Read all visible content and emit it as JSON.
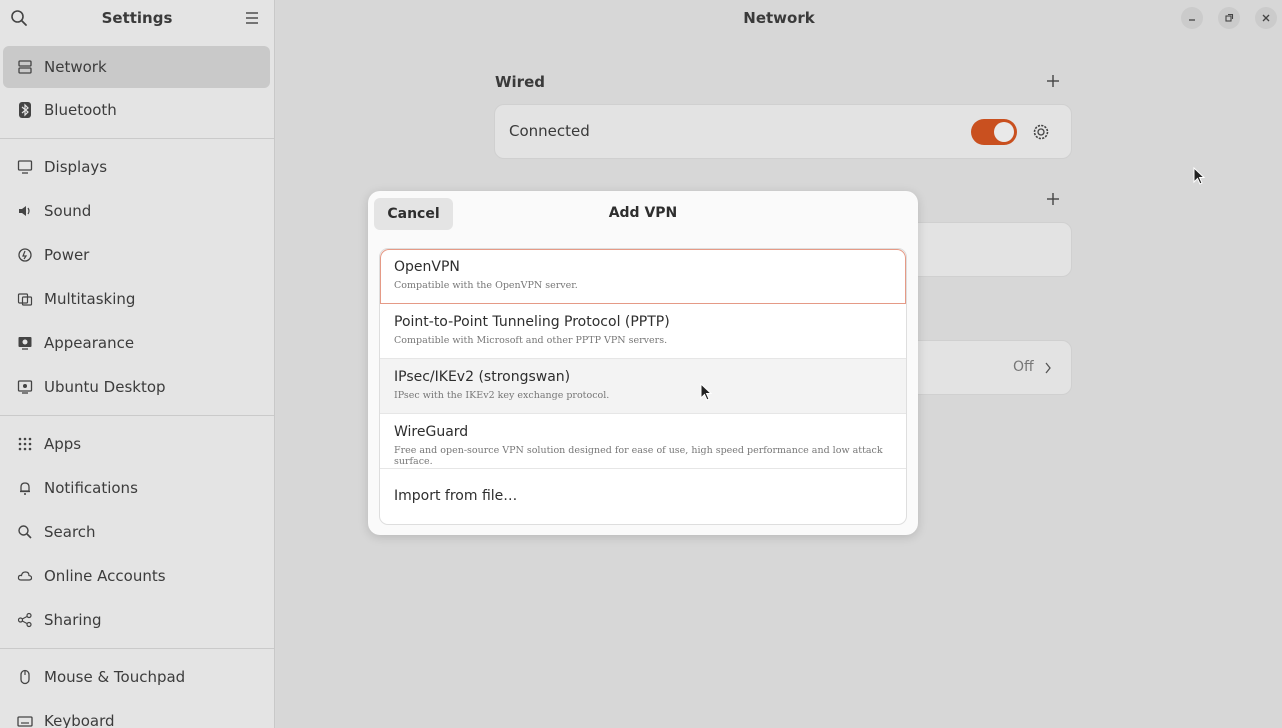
{
  "sidebar": {
    "title": "Settings",
    "groups": [
      [
        {
          "label": "Network",
          "icon": "network-icon",
          "selected": true
        },
        {
          "label": "Bluetooth",
          "icon": "bluetooth-icon"
        }
      ],
      [
        {
          "label": "Displays",
          "icon": "display-icon"
        },
        {
          "label": "Sound",
          "icon": "sound-icon"
        },
        {
          "label": "Power",
          "icon": "power-icon"
        },
        {
          "label": "Multitasking",
          "icon": "multitasking-icon"
        },
        {
          "label": "Appearance",
          "icon": "appearance-icon"
        },
        {
          "label": "Ubuntu Desktop",
          "icon": "ubuntu-desktop-icon"
        }
      ],
      [
        {
          "label": "Apps",
          "icon": "apps-icon"
        },
        {
          "label": "Notifications",
          "icon": "bell-icon"
        },
        {
          "label": "Search",
          "icon": "search-icon"
        },
        {
          "label": "Online Accounts",
          "icon": "cloud-icon"
        },
        {
          "label": "Sharing",
          "icon": "share-icon"
        }
      ],
      [
        {
          "label": "Mouse & Touchpad",
          "icon": "mouse-icon"
        },
        {
          "label": "Keyboard",
          "icon": "keyboard-icon"
        }
      ]
    ]
  },
  "main": {
    "title": "Network",
    "wired": {
      "section_title": "Wired",
      "status": "Connected",
      "toggle_on": true
    },
    "proxy": {
      "value": "Off"
    }
  },
  "dialog": {
    "title": "Add VPN",
    "cancel_label": "Cancel",
    "options": [
      {
        "name": "OpenVPN",
        "description": "Compatible with the OpenVPN server."
      },
      {
        "name": "Point-to-Point Tunneling Protocol (PPTP)",
        "description": "Compatible with Microsoft and other PPTP VPN servers."
      },
      {
        "name": "IPsec/IKEv2 (strongswan)",
        "description": "IPsec with the IKEv2 key exchange protocol."
      },
      {
        "name": "WireGuard",
        "description": "Free and open-source VPN solution designed for ease of use, high speed performance and low attack surface."
      }
    ],
    "import_label": "Import from file…"
  },
  "colors": {
    "accent": "#c9501f",
    "focus_outline": "#e59a86"
  }
}
